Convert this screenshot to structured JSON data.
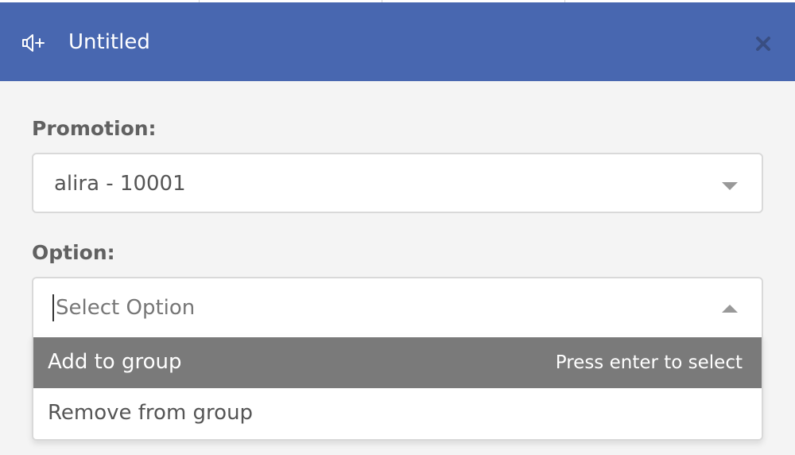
{
  "header": {
    "title": "Untitled",
    "icon": "megaphone-plus-icon",
    "close_icon": "close-icon",
    "background_color": "#4867b0"
  },
  "form": {
    "promotion": {
      "label": "Promotion:",
      "value": "alira - 10001"
    },
    "option": {
      "label": "Option:",
      "placeholder": "Select Option",
      "value": "",
      "menu": {
        "items": [
          {
            "label": "Add to group",
            "highlighted": true
          },
          {
            "label": "Remove from group",
            "highlighted": false
          }
        ],
        "hint": "Press enter to select"
      }
    }
  }
}
